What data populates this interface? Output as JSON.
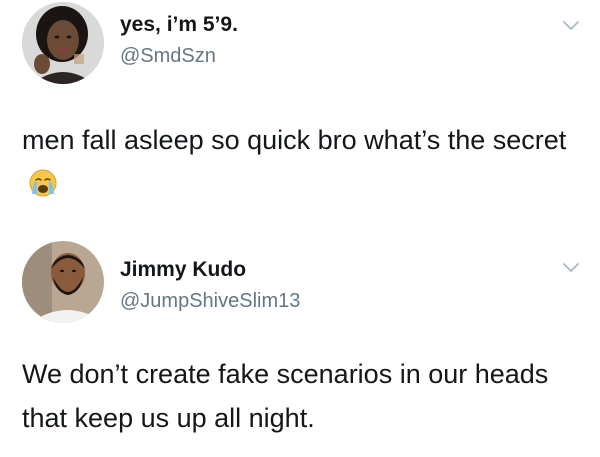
{
  "tweets": [
    {
      "display_name": "yes, i’m 5’9.",
      "handle": "@SmdSzn",
      "text": "men fall asleep so quick bro what’s the secret",
      "emoji": "crying-face",
      "avatar": "woman-avatar"
    },
    {
      "display_name": "Jimmy Kudo",
      "handle": "@JumpShiveSlim13",
      "text": "We don’t create fake scenarios in our heads that keep us up all night.",
      "avatar": "man-avatar"
    }
  ],
  "colors": {
    "text": "#14171a",
    "handle": "#657786",
    "chevron": "#aab8c2",
    "background": "#ffffff"
  }
}
